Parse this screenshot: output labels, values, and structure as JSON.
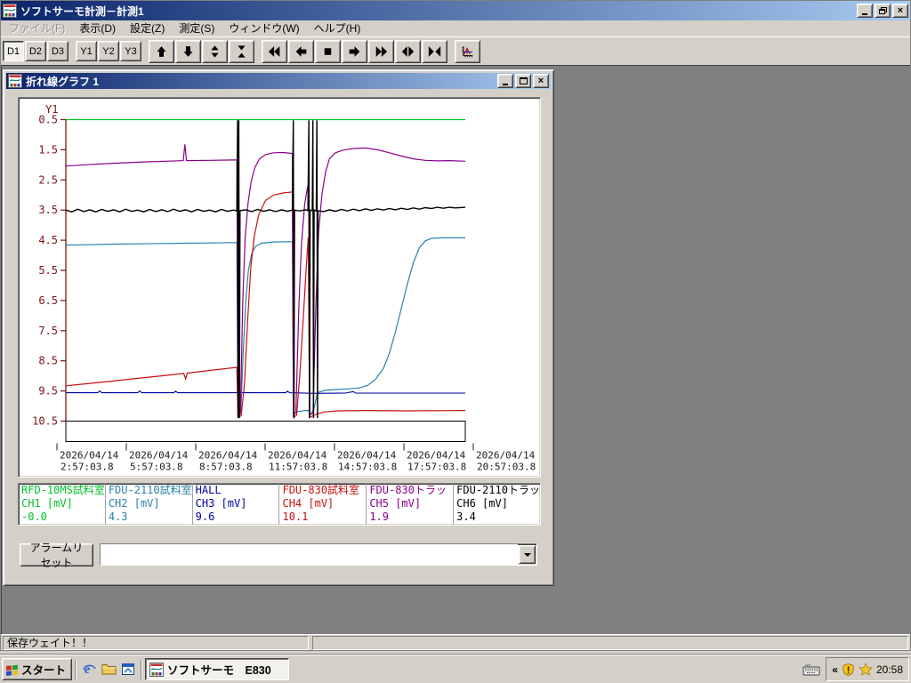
{
  "app_window": {
    "title": "ソフトサーモ計測－計測1",
    "controls": [
      "minimize",
      "restore",
      "close"
    ]
  },
  "menu": {
    "items": [
      {
        "label": "ファイル(F)",
        "disabled": true
      },
      {
        "label": "表示(D)",
        "disabled": false
      },
      {
        "label": "設定(Z)",
        "disabled": false
      },
      {
        "label": "測定(S)",
        "disabled": false
      },
      {
        "label": "ウィンドウ(W)",
        "disabled": false
      },
      {
        "label": "ヘルプ(H)",
        "disabled": false
      }
    ]
  },
  "toolbar": {
    "mode_buttons": [
      {
        "label": "D1",
        "active": true
      },
      {
        "label": "D2",
        "active": false
      },
      {
        "label": "D3",
        "active": false
      },
      {
        "label": "Y1",
        "active": false
      },
      {
        "label": "Y2",
        "active": false
      },
      {
        "label": "Y3",
        "active": false
      }
    ],
    "icon_buttons": [
      "up-arrow",
      "down-arrow",
      "expand-vertical",
      "collapse-vertical",
      "skip-back",
      "left-arrow",
      "stop",
      "right-arrow",
      "skip-forward",
      "expand-horizontal",
      "collapse-horizontal"
    ],
    "graph_setup_button": "graph-setup"
  },
  "graph_window": {
    "title": "折れ線グラフ 1",
    "controls": [
      "minimize",
      "maximize",
      "close"
    ]
  },
  "chart_data": {
    "type": "line",
    "title": "折れ線グラフ 1",
    "axis_color": "#7A1414",
    "date_label_color": "#1a1a1a",
    "y_axis": {
      "label": "Y1",
      "min": 0.5,
      "max": 10.5,
      "inverted_down": true,
      "ticks": [
        "0.5",
        "1.5",
        "2.5",
        "3.5",
        "4.5",
        "5.5",
        "6.5",
        "7.5",
        "8.5",
        "9.5",
        "10.5"
      ]
    },
    "x_axis": {
      "labels": [
        {
          "date": "2026/04/14",
          "time": "2:57:03.8"
        },
        {
          "date": "2026/04/14",
          "time": "5:57:03.8"
        },
        {
          "date": "2026/04/14",
          "time": "8:57:03.8"
        },
        {
          "date": "2026/04/14",
          "time": "11:57:03.8"
        },
        {
          "date": "2026/04/14",
          "time": "14:57:03.8"
        },
        {
          "date": "2026/04/14",
          "time": "17:57:03.8"
        },
        {
          "date": "2026/04/14",
          "time": "20:57:03.8"
        }
      ]
    },
    "series": [
      {
        "id": "CH3",
        "name": "HALL",
        "ch_label": "CH3 [mV]",
        "value": "9.6",
        "color": "#0000A0",
        "width": 1.1,
        "points": [
          [
            0,
            9.56
          ],
          [
            0.08,
            9.56
          ],
          [
            0.085,
            9.5
          ],
          [
            0.09,
            9.56
          ],
          [
            0.18,
            9.56
          ],
          [
            0.185,
            9.5
          ],
          [
            0.19,
            9.56
          ],
          [
            0.27,
            9.56
          ],
          [
            0.275,
            9.51
          ],
          [
            0.28,
            9.56
          ],
          [
            0.43,
            9.56
          ],
          [
            0.55,
            9.56
          ],
          [
            0.555,
            9.51
          ],
          [
            0.56,
            9.56
          ],
          [
            0.62,
            9.58
          ],
          [
            0.7,
            9.57
          ],
          [
            0.72,
            9.52
          ],
          [
            0.725,
            9.57
          ],
          [
            1,
            9.57
          ]
        ]
      },
      {
        "id": "CH2",
        "name": "FDU-2110試料室",
        "ch_label": "CH2 [mV]",
        "value": "4.3",
        "color": "#2782AC",
        "width": 1.2,
        "points": [
          [
            0,
            4.66
          ],
          [
            0.06,
            4.65
          ],
          [
            0.12,
            4.63
          ],
          [
            0.18,
            4.62
          ],
          [
            0.24,
            4.61
          ],
          [
            0.3,
            4.6
          ],
          [
            0.36,
            4.59
          ],
          [
            0.42,
            4.58
          ],
          [
            0.428,
            4.58
          ],
          [
            0.431,
            10.28
          ],
          [
            0.438,
            10.22
          ],
          [
            0.444,
            8.2
          ],
          [
            0.45,
            6.6
          ],
          [
            0.457,
            5.5
          ],
          [
            0.465,
            4.95
          ],
          [
            0.475,
            4.7
          ],
          [
            0.49,
            4.6
          ],
          [
            0.52,
            4.56
          ],
          [
            0.55,
            4.55
          ],
          [
            0.567,
            4.55
          ],
          [
            0.57,
            10.28
          ],
          [
            0.58,
            10.18
          ],
          [
            0.6,
            10.15
          ],
          [
            0.608,
            10.15
          ],
          [
            0.611,
            10.3
          ],
          [
            0.62,
            10.15
          ],
          [
            0.63,
            9.55
          ],
          [
            0.65,
            9.48
          ],
          [
            0.68,
            9.45
          ],
          [
            0.71,
            9.43
          ],
          [
            0.735,
            9.4
          ],
          [
            0.755,
            9.32
          ],
          [
            0.775,
            9.12
          ],
          [
            0.795,
            8.75
          ],
          [
            0.81,
            8.25
          ],
          [
            0.825,
            7.55
          ],
          [
            0.84,
            6.75
          ],
          [
            0.855,
            5.95
          ],
          [
            0.87,
            5.25
          ],
          [
            0.885,
            4.75
          ],
          [
            0.9,
            4.52
          ],
          [
            0.915,
            4.44
          ],
          [
            0.94,
            4.42
          ],
          [
            1,
            4.42
          ]
        ]
      },
      {
        "id": "CH4",
        "name": "FDU-830試料室",
        "ch_label": "CH4 [mV]",
        "value": "10.1",
        "color": "#C81010",
        "width": 1.2,
        "points": [
          [
            0,
            9.33
          ],
          [
            0.06,
            9.25
          ],
          [
            0.12,
            9.17
          ],
          [
            0.18,
            9.08
          ],
          [
            0.24,
            9.0
          ],
          [
            0.295,
            8.92
          ],
          [
            0.3,
            9.1
          ],
          [
            0.304,
            8.91
          ],
          [
            0.36,
            8.82
          ],
          [
            0.42,
            8.73
          ],
          [
            0.428,
            8.72
          ],
          [
            0.431,
            10.38
          ],
          [
            0.439,
            10.32
          ],
          [
            0.447,
            9.3
          ],
          [
            0.455,
            7.2
          ],
          [
            0.463,
            5.4
          ],
          [
            0.472,
            4.35
          ],
          [
            0.483,
            3.65
          ],
          [
            0.5,
            3.18
          ],
          [
            0.52,
            3.0
          ],
          [
            0.545,
            2.93
          ],
          [
            0.567,
            2.9
          ],
          [
            0.57,
            10.38
          ],
          [
            0.578,
            10.3
          ],
          [
            0.586,
            8.9
          ],
          [
            0.594,
            7.2
          ],
          [
            0.601,
            5.6
          ],
          [
            0.607,
            4.4
          ],
          [
            0.61,
            10.38
          ],
          [
            0.625,
            10.28
          ],
          [
            0.645,
            10.2
          ],
          [
            0.68,
            10.16
          ],
          [
            0.75,
            10.15
          ],
          [
            0.85,
            10.16
          ],
          [
            1,
            10.15
          ]
        ]
      },
      {
        "id": "CH5",
        "name": "FDU-830トラッ",
        "ch_label": "CH5 [mV]",
        "value": "1.9",
        "color": "#8B008B",
        "width": 1.2,
        "points": [
          [
            0,
            2.04
          ],
          [
            0.05,
            2.0
          ],
          [
            0.1,
            1.96
          ],
          [
            0.15,
            1.93
          ],
          [
            0.2,
            1.9
          ],
          [
            0.25,
            1.88
          ],
          [
            0.294,
            1.86
          ],
          [
            0.298,
            1.32
          ],
          [
            0.302,
            1.86
          ],
          [
            0.36,
            1.85
          ],
          [
            0.42,
            1.84
          ],
          [
            0.428,
            1.84
          ],
          [
            0.431,
            10.3
          ],
          [
            0.437,
            10.25
          ],
          [
            0.443,
            6.5
          ],
          [
            0.449,
            4.4
          ],
          [
            0.456,
            3.3
          ],
          [
            0.464,
            2.55
          ],
          [
            0.473,
            2.1
          ],
          [
            0.484,
            1.82
          ],
          [
            0.5,
            1.66
          ],
          [
            0.52,
            1.6
          ],
          [
            0.545,
            1.59
          ],
          [
            0.567,
            1.62
          ],
          [
            0.57,
            10.3
          ],
          [
            0.576,
            10.22
          ],
          [
            0.583,
            6.8
          ],
          [
            0.59,
            4.6
          ],
          [
            0.598,
            3.3
          ],
          [
            0.605,
            2.75
          ],
          [
            0.608,
            2.6
          ],
          [
            0.611,
            10.3
          ],
          [
            0.619,
            10.22
          ],
          [
            0.626,
            6.6
          ],
          [
            0.633,
            4.2
          ],
          [
            0.641,
            3.0
          ],
          [
            0.65,
            2.25
          ],
          [
            0.66,
            1.8
          ],
          [
            0.675,
            1.6
          ],
          [
            0.695,
            1.51
          ],
          [
            0.72,
            1.46
          ],
          [
            0.75,
            1.44
          ],
          [
            0.78,
            1.5
          ],
          [
            0.81,
            1.6
          ],
          [
            0.84,
            1.71
          ],
          [
            0.87,
            1.8
          ],
          [
            0.9,
            1.85
          ],
          [
            0.93,
            1.87
          ],
          [
            0.96,
            1.86
          ],
          [
            1,
            1.88
          ]
        ]
      },
      {
        "id": "CH6",
        "name": "FDU-2110トラッ",
        "ch_label": "CH6 [mV]",
        "value": "3.4",
        "color": "#000000",
        "width": 1.4,
        "points": [
          [
            0,
            3.5
          ],
          [
            0.015,
            3.56
          ],
          [
            0.03,
            3.47
          ],
          [
            0.045,
            3.55
          ],
          [
            0.06,
            3.49
          ],
          [
            0.075,
            3.56
          ],
          [
            0.09,
            3.48
          ],
          [
            0.105,
            3.54
          ],
          [
            0.12,
            3.49
          ],
          [
            0.135,
            3.56
          ],
          [
            0.15,
            3.47
          ],
          [
            0.165,
            3.54
          ],
          [
            0.18,
            3.5
          ],
          [
            0.195,
            3.56
          ],
          [
            0.21,
            3.48
          ],
          [
            0.225,
            3.55
          ],
          [
            0.24,
            3.49
          ],
          [
            0.255,
            3.55
          ],
          [
            0.27,
            3.47
          ],
          [
            0.285,
            3.54
          ],
          [
            0.3,
            3.49
          ],
          [
            0.315,
            3.56
          ],
          [
            0.33,
            3.48
          ],
          [
            0.345,
            3.54
          ],
          [
            0.36,
            3.5
          ],
          [
            0.375,
            3.56
          ],
          [
            0.39,
            3.48
          ],
          [
            0.405,
            3.54
          ],
          [
            0.42,
            3.5
          ],
          [
            0.428,
            3.53
          ],
          [
            0.43,
            0.52
          ],
          [
            0.4315,
            10.4
          ],
          [
            0.433,
            0.52
          ],
          [
            0.4345,
            10.4
          ],
          [
            0.436,
            3.52
          ],
          [
            0.45,
            3.49
          ],
          [
            0.465,
            3.55
          ],
          [
            0.48,
            3.48
          ],
          [
            0.495,
            3.54
          ],
          [
            0.51,
            3.49
          ],
          [
            0.525,
            3.55
          ],
          [
            0.54,
            3.49
          ],
          [
            0.555,
            3.54
          ],
          [
            0.567,
            3.5
          ],
          [
            0.5695,
            0.52
          ],
          [
            0.571,
            10.4
          ],
          [
            0.5725,
            3.5
          ],
          [
            0.585,
            3.53
          ],
          [
            0.6,
            3.49
          ],
          [
            0.606,
            3.52
          ],
          [
            0.6085,
            0.52
          ],
          [
            0.61,
            10.4
          ],
          [
            0.6115,
            3.5
          ],
          [
            0.617,
            3.52
          ],
          [
            0.6185,
            0.52
          ],
          [
            0.62,
            10.4
          ],
          [
            0.6215,
            3.5
          ],
          [
            0.627,
            3.53
          ],
          [
            0.6285,
            0.52
          ],
          [
            0.63,
            10.4
          ],
          [
            0.6315,
            3.52
          ],
          [
            0.645,
            3.55
          ],
          [
            0.66,
            3.49
          ],
          [
            0.675,
            3.54
          ],
          [
            0.69,
            3.48
          ],
          [
            0.705,
            3.53
          ],
          [
            0.72,
            3.47
          ],
          [
            0.735,
            3.52
          ],
          [
            0.75,
            3.46
          ],
          [
            0.765,
            3.51
          ],
          [
            0.78,
            3.46
          ],
          [
            0.795,
            3.5
          ],
          [
            0.81,
            3.45
          ],
          [
            0.825,
            3.49
          ],
          [
            0.84,
            3.44
          ],
          [
            0.855,
            3.48
          ],
          [
            0.87,
            3.43
          ],
          [
            0.885,
            3.47
          ],
          [
            0.9,
            3.42
          ],
          [
            0.915,
            3.45
          ],
          [
            0.93,
            3.41
          ],
          [
            0.945,
            3.44
          ],
          [
            0.96,
            3.41
          ],
          [
            0.975,
            3.43
          ],
          [
            1,
            3.41
          ]
        ]
      },
      {
        "id": "CH1",
        "name": "RFD-10MS試料室",
        "ch_label": "CH1 [mV]",
        "value": "-0.0",
        "color": "#00C028",
        "width": 1.2,
        "points": [
          [
            0,
            0.5
          ],
          [
            1,
            0.5
          ]
        ]
      }
    ],
    "legend_order": [
      "CH1",
      "CH2",
      "CH3",
      "CH4",
      "CH5",
      "CH6"
    ]
  },
  "alarm": {
    "reset_label": "アラームリセット",
    "combo_value": ""
  },
  "status_bar": {
    "left": "保存ウェイト！！",
    "right": ""
  },
  "taskbar": {
    "start_label": "スタート",
    "quick_launch": [
      "ie-icon",
      "folder-icon",
      "window-icon"
    ],
    "task_button_label": "ソフトサーモ　E830",
    "tray": {
      "chevron": "«",
      "time": "20:58"
    }
  }
}
